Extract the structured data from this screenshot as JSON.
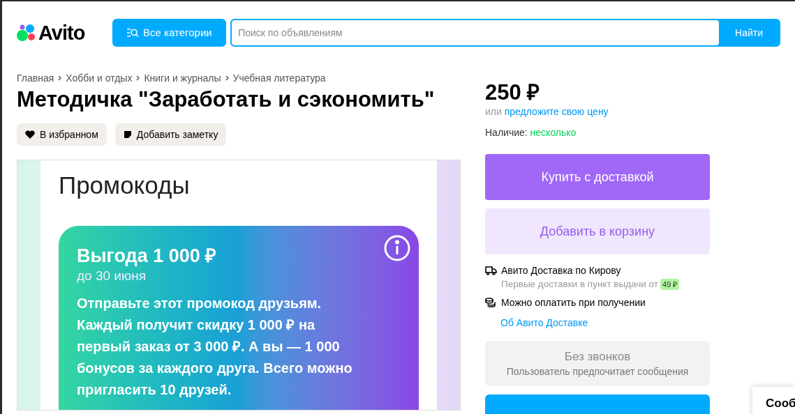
{
  "header": {
    "logo": "Avito",
    "categories_button": "Все категории",
    "search": {
      "placeholder": "Поиск по объявлениям"
    },
    "search_button": "Найти"
  },
  "breadcrumbs": [
    "Главная",
    "Хобби и отдых",
    "Книги и журналы",
    "Учебная литература"
  ],
  "title": "Методичка \"Заработать и сэкономить\"",
  "actions": [
    {
      "kind": "favorite",
      "label": "В избранном"
    },
    {
      "kind": "note",
      "label": "Добавить заметку"
    }
  ],
  "gallery": {
    "screen_title": "Промокоды",
    "promo": {
      "title": "Выгода 1 000 ₽",
      "subtitle": "до 30 июня",
      "text": "Отправьте этот промокод друзьям. Каждый получит скидку 1 000 ₽ на первый заказ от 3 000 ₽. А вы — 1 000 бонусов за каждого друга. Всего можно пригласить 10 друзей."
    }
  },
  "price": {
    "value": "250 ₽",
    "prefix": "или",
    "offer_link": "предложите свою цену"
  },
  "availability": {
    "label": "Наличие:",
    "value": "несколько"
  },
  "buy_button": "Купить с доставкой",
  "cart_button": "Добавить в корзину",
  "delivery": [
    {
      "kind": "truck",
      "title": "Авито Доставка по Кирову",
      "subtitle": "Первые доставки в пункт выдачи от",
      "badge": "49 ₽"
    },
    {
      "kind": "coins",
      "title": "Можно оплатить при получении"
    }
  ],
  "delivery_link": "Об Авито Доставке",
  "no_calls": {
    "title": "Без звонков",
    "subtitle": "Пользователь предпочитает сообщения"
  },
  "chat_tab": "Сооб"
}
